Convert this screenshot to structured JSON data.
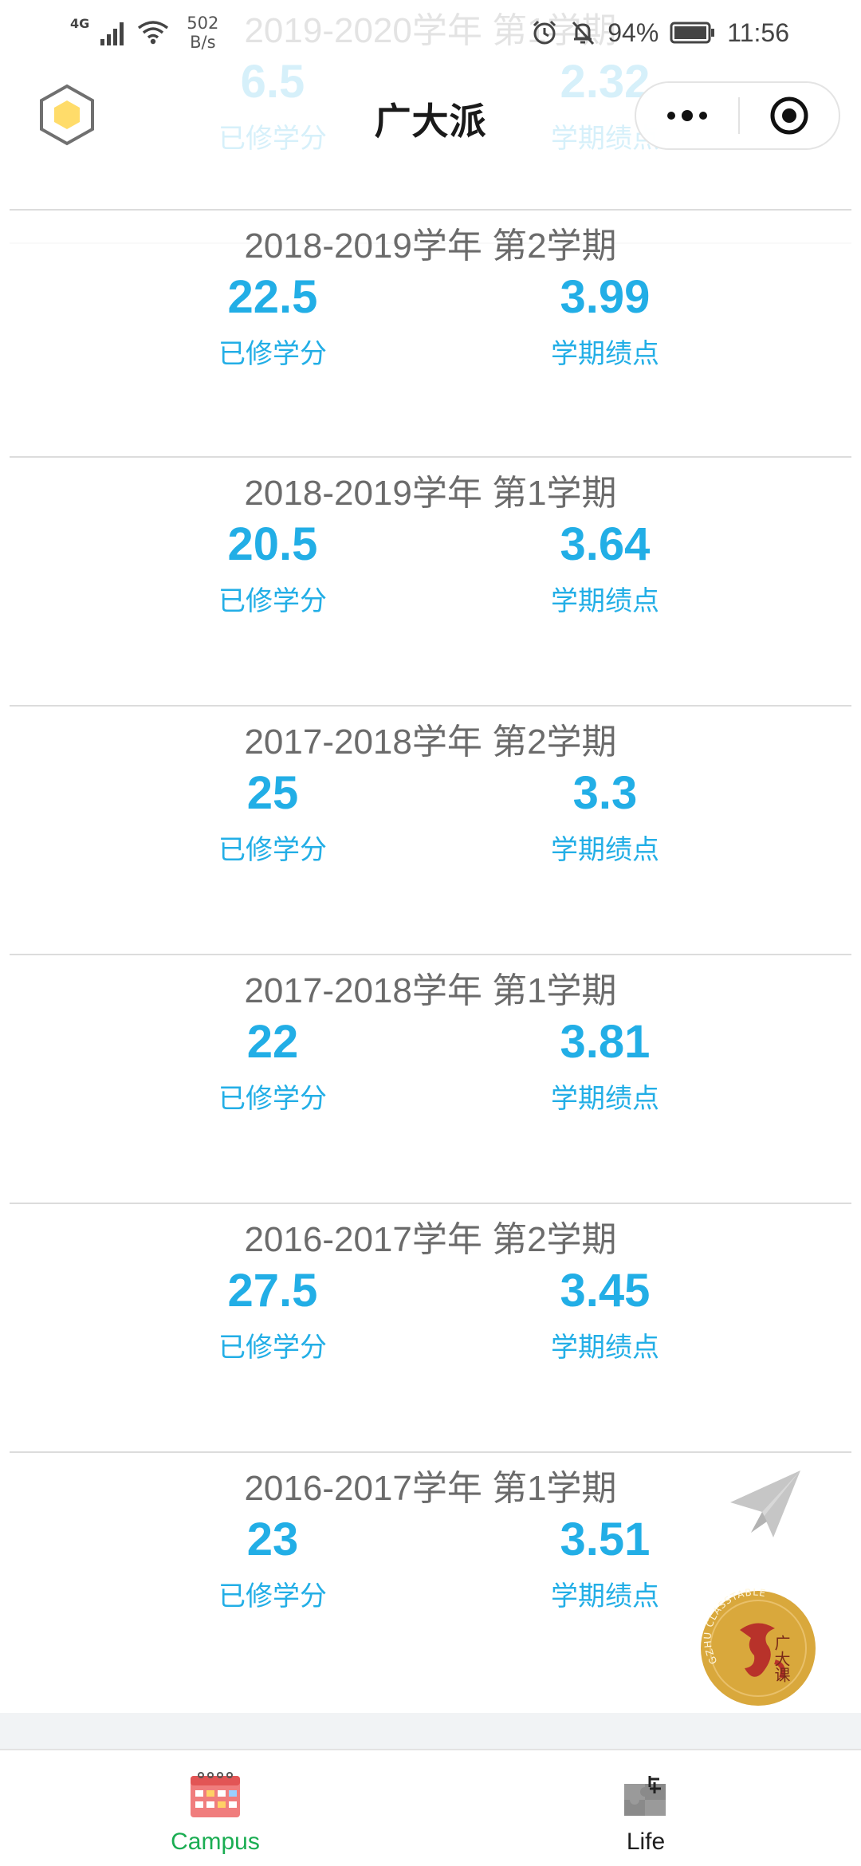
{
  "status_bar": {
    "network_type": "4G",
    "speed_value": "502",
    "speed_unit": "B/s",
    "battery": "94%",
    "time": "11:56"
  },
  "header": {
    "title": "广大派"
  },
  "terms": [
    {
      "title": "2019-2020学年 第1学期",
      "credits": "6.5",
      "credits_label": "已修学分",
      "gpa": "2.32",
      "gpa_label": "学期绩点"
    },
    {
      "title": "2018-2019学年 第2学期",
      "credits": "22.5",
      "credits_label": "已修学分",
      "gpa": "3.99",
      "gpa_label": "学期绩点"
    },
    {
      "title": "2018-2019学年 第1学期",
      "credits": "20.5",
      "credits_label": "已修学分",
      "gpa": "3.64",
      "gpa_label": "学期绩点"
    },
    {
      "title": "2017-2018学年 第2学期",
      "credits": "25",
      "credits_label": "已修学分",
      "gpa": "3.3",
      "gpa_label": "学期绩点"
    },
    {
      "title": "2017-2018学年 第1学期",
      "credits": "22",
      "credits_label": "已修学分",
      "gpa": "3.81",
      "gpa_label": "学期绩点"
    },
    {
      "title": "2016-2017学年 第2学期",
      "credits": "27.5",
      "credits_label": "已修学分",
      "gpa": "3.45",
      "gpa_label": "学期绩点"
    },
    {
      "title": "2016-2017学年 第1学期",
      "credits": "23",
      "credits_label": "已修学分",
      "gpa": "3.51",
      "gpa_label": "学期绩点"
    }
  ],
  "floating": {
    "badge_text": "GZHU CLASSTABLE",
    "badge_chars": "广大课"
  },
  "tabbar": {
    "items": [
      {
        "label": "Campus",
        "icon": "calendar-icon",
        "active": true
      },
      {
        "label": "Life",
        "icon": "puzzle-icon",
        "active": false
      }
    ]
  },
  "colors": {
    "accent": "#22aee6",
    "tab_active": "#1aad52",
    "title_gray": "#6b6b6b",
    "badge_gold": "#d9a83c"
  }
}
